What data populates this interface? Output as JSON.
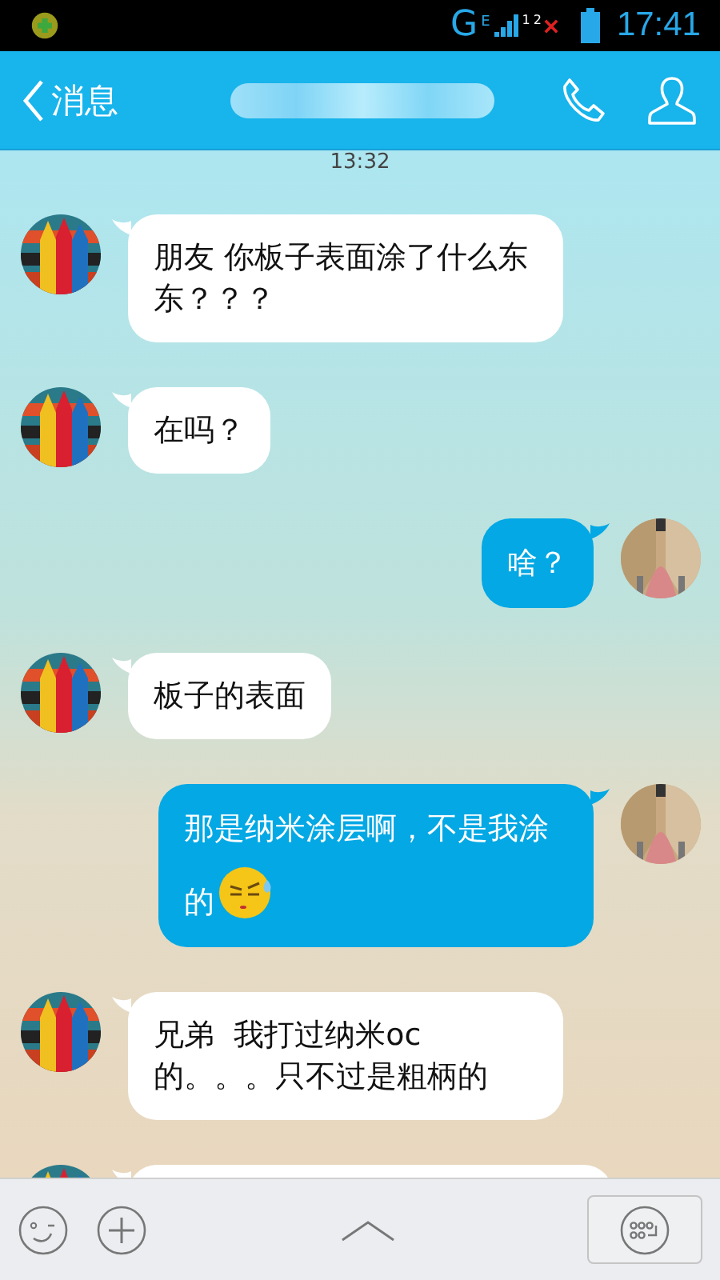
{
  "status_bar": {
    "network": "G",
    "network_sub": "E",
    "sim1": "1",
    "sim2": "2",
    "time": "17:41"
  },
  "header": {
    "back_label": "消息"
  },
  "timestamp": "13:32",
  "messages": [
    {
      "kind": "incoming",
      "text": "朋友 你板子表面涂了什么东东？？？"
    },
    {
      "kind": "incoming",
      "text": "在吗？"
    },
    {
      "kind": "outgoing",
      "text": "啥？"
    },
    {
      "kind": "incoming",
      "text": "板子的表面"
    },
    {
      "kind": "outgoing",
      "text": "那是纳米涂层啊，不是我涂的",
      "emoji": true
    },
    {
      "kind": "incoming",
      "text": "兄弟  我打过纳米oc的。。。只不过是粗柄的"
    },
    {
      "kind": "incoming"
    }
  ]
}
